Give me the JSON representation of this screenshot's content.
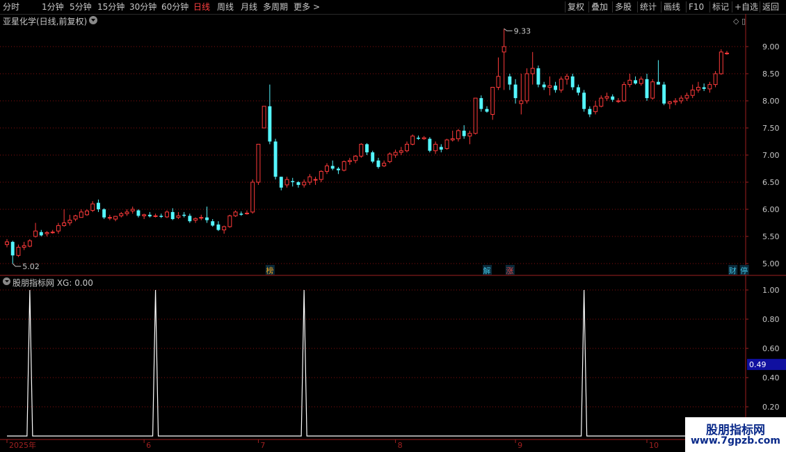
{
  "toolbar": {
    "periods": [
      {
        "label": "分时",
        "active": false
      },
      {
        "label": "1分钟",
        "active": false
      },
      {
        "label": "5分钟",
        "active": false
      },
      {
        "label": "15分钟",
        "active": false
      },
      {
        "label": "30分钟",
        "active": false
      },
      {
        "label": "60分钟",
        "active": false
      },
      {
        "label": "日线",
        "active": true
      },
      {
        "label": "周线",
        "active": false
      },
      {
        "label": "月线",
        "active": false
      },
      {
        "label": "多周期",
        "active": false
      },
      {
        "label": "更多",
        "active": false
      }
    ],
    "more_glyph": ">",
    "actions": [
      "复权",
      "叠加",
      "多股",
      "统计",
      "画线",
      "F10",
      "标记",
      "+自选",
      "返回"
    ]
  },
  "stock_title": "亚星化学(日线,前复权)",
  "indicator_title": "股朋指标网 XG: 0.00",
  "price_axis": [
    "9.00",
    "8.50",
    "8.00",
    "7.50",
    "7.00",
    "6.50",
    "6.00",
    "5.50",
    "5.00"
  ],
  "price_axis_values": [
    9.0,
    8.5,
    8.0,
    7.5,
    7.0,
    6.5,
    6.0,
    5.5,
    5.0
  ],
  "indicator_axis": [
    "1.00",
    "0.80",
    "0.60",
    "0.40",
    "0.20"
  ],
  "indicator_axis_values": [
    1.0,
    0.8,
    0.6,
    0.4,
    0.2
  ],
  "indicator_current": "0.49",
  "high_label": "9.33",
  "low_label": "5.02",
  "event_markers": [
    {
      "text": "榜",
      "color": "#e8a020",
      "date_index": 46
    },
    {
      "text": "解",
      "color": "#40c0e0",
      "date_index": 84
    },
    {
      "text": "涨",
      "color": "#e04040",
      "date_index": 88
    },
    {
      "text": "财",
      "color": "#40c0e0",
      "date_index": 127
    },
    {
      "text": "停",
      "color": "#40c0e0",
      "date_index": 129
    }
  ],
  "date_axis": [
    "2025年",
    "6",
    "7",
    "8",
    "9",
    "10"
  ],
  "date_axis_index": [
    0,
    24,
    44,
    68,
    89,
    112
  ],
  "watermark": {
    "line1": "股朋指标网",
    "line2": "www.7gpzb.com"
  },
  "colors": {
    "up": "#ff3a3a",
    "down": "#54f6ff",
    "grid": "#8a1010",
    "axis": "#a02020"
  },
  "chart_data": {
    "type": "candlestick",
    "title": "亚星化学(日线,前复权)",
    "ylim": [
      4.9,
      9.4
    ],
    "candles": [
      [
        5.35,
        5.45,
        5.3,
        5.4
      ],
      [
        5.4,
        5.42,
        5.0,
        5.15
      ],
      [
        5.15,
        5.35,
        5.12,
        5.3
      ],
      [
        5.3,
        5.4,
        5.25,
        5.33
      ],
      [
        5.32,
        5.45,
        5.3,
        5.42
      ],
      [
        5.5,
        5.75,
        5.48,
        5.6
      ],
      [
        5.58,
        5.62,
        5.5,
        5.52
      ],
      [
        5.55,
        5.6,
        5.5,
        5.57
      ],
      [
        5.57,
        5.62,
        5.55,
        5.58
      ],
      [
        5.6,
        5.75,
        5.55,
        5.7
      ],
      [
        5.7,
        6.0,
        5.68,
        5.75
      ],
      [
        5.75,
        5.9,
        5.7,
        5.8
      ],
      [
        5.82,
        5.9,
        5.78,
        5.88
      ],
      [
        5.85,
        6.0,
        5.85,
        5.95
      ],
      [
        5.9,
        6.0,
        5.88,
        5.97
      ],
      [
        5.98,
        6.15,
        5.95,
        6.1
      ],
      [
        6.12,
        6.18,
        5.95,
        6.0
      ],
      [
        6.0,
        6.02,
        5.82,
        5.85
      ],
      [
        5.85,
        5.9,
        5.8,
        5.85
      ],
      [
        5.82,
        5.88,
        5.78,
        5.87
      ],
      [
        5.88,
        5.95,
        5.85,
        5.92
      ],
      [
        5.92,
        6.0,
        5.88,
        5.95
      ],
      [
        5.97,
        6.05,
        5.92,
        6.0
      ],
      [
        5.98,
        6.0,
        5.85,
        5.88
      ],
      [
        5.88,
        5.92,
        5.82,
        5.9
      ],
      [
        5.9,
        5.95,
        5.85,
        5.87
      ],
      [
        5.87,
        5.92,
        5.85,
        5.88
      ],
      [
        5.88,
        5.92,
        5.84,
        5.86
      ],
      [
        5.86,
        5.98,
        5.84,
        5.95
      ],
      [
        5.95,
        6.02,
        5.8,
        5.82
      ],
      [
        5.85,
        5.95,
        5.82,
        5.88
      ],
      [
        5.9,
        5.95,
        5.85,
        5.88
      ],
      [
        5.88,
        5.92,
        5.75,
        5.78
      ],
      [
        5.8,
        5.85,
        5.75,
        5.83
      ],
      [
        5.84,
        5.9,
        5.8,
        5.85
      ],
      [
        5.85,
        6.05,
        5.75,
        5.8
      ],
      [
        5.78,
        5.82,
        5.68,
        5.7
      ],
      [
        5.72,
        5.78,
        5.6,
        5.62
      ],
      [
        5.62,
        5.7,
        5.55,
        5.68
      ],
      [
        5.68,
        5.9,
        5.66,
        5.88
      ],
      [
        5.88,
        5.98,
        5.86,
        5.95
      ],
      [
        5.92,
        5.96,
        5.88,
        5.9
      ],
      [
        5.92,
        5.98,
        5.9,
        5.93
      ],
      [
        5.95,
        6.55,
        5.92,
        6.5
      ],
      [
        6.5,
        7.2,
        6.45,
        7.2
      ],
      [
        7.5,
        7.9,
        7.5,
        7.9
      ],
      [
        7.9,
        8.3,
        7.2,
        7.25
      ],
      [
        7.25,
        7.3,
        6.55,
        6.6
      ],
      [
        6.6,
        6.6,
        6.35,
        6.4
      ],
      [
        6.45,
        6.6,
        6.4,
        6.55
      ],
      [
        6.52,
        6.58,
        6.42,
        6.5
      ],
      [
        6.5,
        6.52,
        6.4,
        6.45
      ],
      [
        6.45,
        6.55,
        6.4,
        6.5
      ],
      [
        6.5,
        6.65,
        6.45,
        6.6
      ],
      [
        6.55,
        6.6,
        6.45,
        6.55
      ],
      [
        6.55,
        6.72,
        6.5,
        6.7
      ],
      [
        6.7,
        6.85,
        6.65,
        6.8
      ],
      [
        6.8,
        6.9,
        6.72,
        6.75
      ],
      [
        6.75,
        6.78,
        6.65,
        6.72
      ],
      [
        6.72,
        6.9,
        6.7,
        6.88
      ],
      [
        6.88,
        6.95,
        6.82,
        6.9
      ],
      [
        6.9,
        7.0,
        6.85,
        6.98
      ],
      [
        6.98,
        7.22,
        6.95,
        7.2
      ],
      [
        7.2,
        7.22,
        7.0,
        7.05
      ],
      [
        7.05,
        7.08,
        6.85,
        6.88
      ],
      [
        6.9,
        6.95,
        6.75,
        6.78
      ],
      [
        6.8,
        6.9,
        6.78,
        6.85
      ],
      [
        6.88,
        7.05,
        6.85,
        7.02
      ],
      [
        7.0,
        7.1,
        6.95,
        7.05
      ],
      [
        7.05,
        7.15,
        7.0,
        7.08
      ],
      [
        7.08,
        7.25,
        7.05,
        7.2
      ],
      [
        7.2,
        7.38,
        7.18,
        7.35
      ],
      [
        7.32,
        7.36,
        7.28,
        7.3
      ],
      [
        7.3,
        7.35,
        7.28,
        7.32
      ],
      [
        7.3,
        7.33,
        7.05,
        7.08
      ],
      [
        7.08,
        7.25,
        7.02,
        7.2
      ],
      [
        7.15,
        7.2,
        7.05,
        7.1
      ],
      [
        7.12,
        7.3,
        7.1,
        7.28
      ],
      [
        7.28,
        7.45,
        7.25,
        7.3
      ],
      [
        7.3,
        7.48,
        7.25,
        7.45
      ],
      [
        7.45,
        7.55,
        7.3,
        7.35
      ],
      [
        7.35,
        7.45,
        7.2,
        7.4
      ],
      [
        7.4,
        8.05,
        7.38,
        8.05
      ],
      [
        8.05,
        8.1,
        7.8,
        7.85
      ],
      [
        7.85,
        7.9,
        7.78,
        7.8
      ],
      [
        7.75,
        8.0,
        7.65,
        8.25
      ],
      [
        8.25,
        8.8,
        8.2,
        8.45
      ],
      [
        8.9,
        9.33,
        8.2,
        9.0
      ],
      [
        8.45,
        8.5,
        8.2,
        8.3
      ],
      [
        8.3,
        8.4,
        7.95,
        8.05
      ],
      [
        7.95,
        8.5,
        7.75,
        8.0
      ],
      [
        8.0,
        8.6,
        7.95,
        8.5
      ],
      [
        8.5,
        8.9,
        8.3,
        8.6
      ],
      [
        8.6,
        8.65,
        8.25,
        8.3
      ],
      [
        8.3,
        8.35,
        8.2,
        8.25
      ],
      [
        8.25,
        8.45,
        8.1,
        8.28
      ],
      [
        8.28,
        8.35,
        8.15,
        8.2
      ],
      [
        8.2,
        8.45,
        8.15,
        8.4
      ],
      [
        8.4,
        8.5,
        8.3,
        8.45
      ],
      [
        8.45,
        8.5,
        8.2,
        8.25
      ],
      [
        8.25,
        8.3,
        8.1,
        8.15
      ],
      [
        8.15,
        8.2,
        7.8,
        7.85
      ],
      [
        7.85,
        7.9,
        7.7,
        7.75
      ],
      [
        7.8,
        8.0,
        7.75,
        7.9
      ],
      [
        7.9,
        8.1,
        7.88,
        8.05
      ],
      [
        8.05,
        8.15,
        8.0,
        8.08
      ],
      [
        8.08,
        8.12,
        7.98,
        8.02
      ],
      [
        8.0,
        8.05,
        7.96,
        8.0
      ],
      [
        8.0,
        8.35,
        7.98,
        8.3
      ],
      [
        8.3,
        8.5,
        8.25,
        8.38
      ],
      [
        8.38,
        8.45,
        8.3,
        8.32
      ],
      [
        8.32,
        8.45,
        8.28,
        8.4
      ],
      [
        8.4,
        8.5,
        8.0,
        8.05
      ],
      [
        8.05,
        8.4,
        8.02,
        8.35
      ],
      [
        8.35,
        8.75,
        8.3,
        8.3
      ],
      [
        8.3,
        8.35,
        7.92,
        7.95
      ],
      [
        7.95,
        8.0,
        7.85,
        7.98
      ],
      [
        7.98,
        8.05,
        7.92,
        8.0
      ],
      [
        8.0,
        8.1,
        7.95,
        8.05
      ],
      [
        8.05,
        8.15,
        8.0,
        8.1
      ],
      [
        8.1,
        8.3,
        8.05,
        8.2
      ],
      [
        8.2,
        8.35,
        8.15,
        8.25
      ],
      [
        8.25,
        8.32,
        8.18,
        8.22
      ],
      [
        8.22,
        8.35,
        8.15,
        8.3
      ],
      [
        8.3,
        8.55,
        8.25,
        8.5
      ],
      [
        8.5,
        8.95,
        8.48,
        8.9
      ],
      [
        8.88,
        8.92,
        8.85,
        8.88
      ]
    ],
    "indicator": {
      "name": "XG",
      "peaks": [
        4,
        26,
        52,
        101
      ],
      "ylim": [
        0,
        1
      ]
    }
  }
}
